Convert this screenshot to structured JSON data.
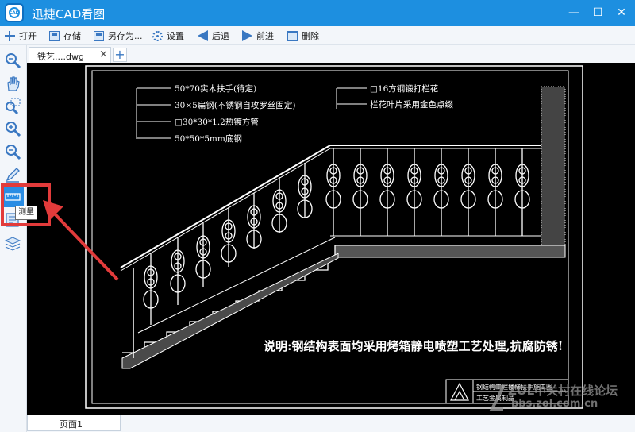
{
  "app": {
    "logo_text": "CAD",
    "title": "迅捷CAD看图"
  },
  "window_controls": {
    "minimize": "—",
    "maximize": "☐",
    "close": "✕"
  },
  "toolbar": {
    "items": [
      {
        "label": "打开",
        "icon": "plus-icon"
      },
      {
        "label": "存储",
        "icon": "save-icon"
      },
      {
        "label": "另存为...",
        "icon": "save-as-icon"
      },
      {
        "label": "设置",
        "icon": "gear-icon"
      },
      {
        "label": "后退",
        "icon": "back-arrow-icon"
      },
      {
        "label": "前进",
        "icon": "forward-arrow-icon"
      },
      {
        "label": "删除",
        "icon": "trash-icon"
      }
    ]
  },
  "sidebar": {
    "tools": [
      {
        "name": "zoom-extents",
        "icon": "zoom-extents-icon"
      },
      {
        "name": "pan",
        "icon": "hand-pan-icon"
      },
      {
        "name": "zoom-window",
        "icon": "zoom-window-icon"
      },
      {
        "name": "zoom-in",
        "icon": "zoom-in-icon"
      },
      {
        "name": "zoom-out",
        "icon": "zoom-out-icon"
      },
      {
        "name": "draw",
        "icon": "pencil-icon"
      },
      {
        "name": "measure",
        "icon": "measure-icon",
        "active": true
      },
      {
        "name": "text",
        "icon": "text-icon"
      },
      {
        "name": "layers",
        "icon": "layers-icon"
      }
    ],
    "tooltip": "测量"
  },
  "tabs": {
    "document_tab": "铁艺....dwg",
    "close_symbol": "×",
    "new_tab_symbol": "+"
  },
  "drawing": {
    "callouts_left": [
      "50*70实木扶手(待定)",
      "30×5扁钢(不锈钢自攻罗丝固定)",
      "□30*30*1.2热镀方管",
      "50*50*5mm底钢"
    ],
    "callouts_right": [
      "□16方钢锻打栏花",
      "栏花叶片采用金色点缀"
    ],
    "note": "说明:钢结构表面均采用烤箱静电喷塑工艺处理,抗腐防锈!",
    "title_block_line1": "钢结构工程楼梯扶手施工图",
    "title_block_line2": "工艺金属制品"
  },
  "pages": {
    "page_tab": "页面1"
  },
  "watermark": {
    "text": "ZOL中关村在线论坛",
    "url": "bbs.zol.com.cn"
  },
  "colors": {
    "titlebar": "#1d8fe0",
    "canvas_bg": "#000000",
    "highlight": "#e23b3b",
    "active_tool": "#2a8de4"
  }
}
